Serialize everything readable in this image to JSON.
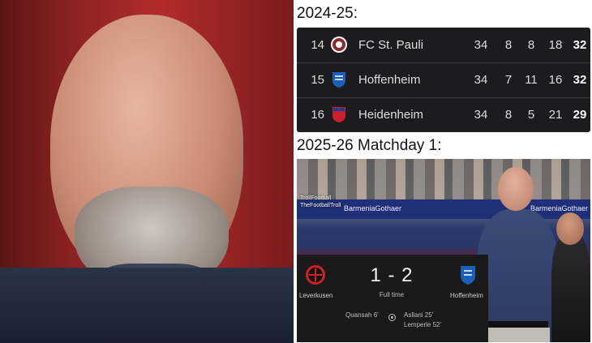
{
  "headings": {
    "season": "2024-25:",
    "matchday": "2025-26 Matchday 1:"
  },
  "standings": [
    {
      "pos": "14",
      "team": "FC St. Pauli",
      "played": "34",
      "won": "8",
      "drawn": "8",
      "lost": "18",
      "points": "32",
      "crest": "st-pauli-crest-icon",
      "crest_color": "#8b2a2a"
    },
    {
      "pos": "15",
      "team": "Hoffenheim",
      "played": "34",
      "won": "7",
      "drawn": "11",
      "lost": "16",
      "points": "32",
      "crest": "hoffenheim-crest-icon",
      "crest_color": "#1c5fb8"
    },
    {
      "pos": "16",
      "team": "Heidenheim",
      "played": "34",
      "won": "8",
      "drawn": "5",
      "lost": "21",
      "points": "29",
      "crest": "heidenheim-crest-icon",
      "crest_color": "#cc1f2d"
    }
  ],
  "match": {
    "home": "Leverkusen",
    "away": "Hoffenheim",
    "score": "1 - 2",
    "status": "Full time",
    "home_scorers": [
      "Quansah 6'"
    ],
    "away_scorers": [
      "Asllani 25'",
      "Lemperle 52'"
    ],
    "home_crest": "leverkusen-crest-icon",
    "away_crest": "hoffenheim-crest-icon"
  },
  "photo": {
    "watermark_1": "TrollFootball",
    "watermark_2": "TheFootballTroll",
    "ad_1": "BarmeniaGothaer",
    "ad_2": "BarmeniaGothaer"
  },
  "colors": {
    "table_bg": "#1c1c1e",
    "score_bg": "#1a1a1a",
    "leverkusen_red": "#d21f26",
    "hoffenheim_blue": "#1c5fb8"
  }
}
